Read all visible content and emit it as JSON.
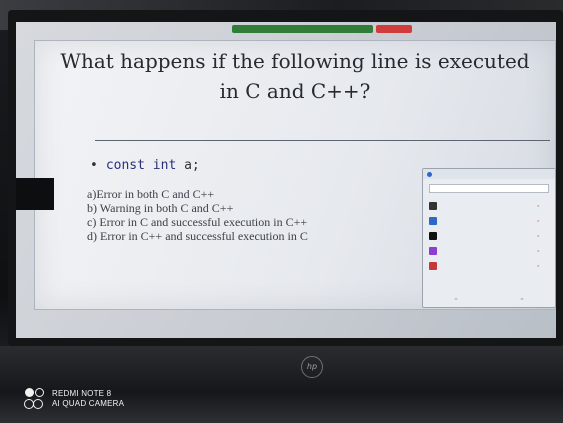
{
  "slide": {
    "title_line1": "What happens if the following line is executed",
    "title_line2": "in C and C++?",
    "code": {
      "keyword_const": "const",
      "keyword_int": "int",
      "identifier": "a;"
    },
    "options": [
      "a)Error in both C and C++",
      "b) Warning in both C and C++",
      "c) Error in C and successful execution in C++",
      "d) Error in C++ and successful execution in C"
    ]
  },
  "participants_panel": {
    "avatar_colors": [
      "#333333",
      "#2d68c4",
      "#111111",
      "#8a3fd1",
      "#c43a3a"
    ]
  },
  "laptop": {
    "logo": "hp"
  },
  "watermark": {
    "line1": "REDMI NOTE 8",
    "line2": "AI QUAD CAMERA"
  }
}
